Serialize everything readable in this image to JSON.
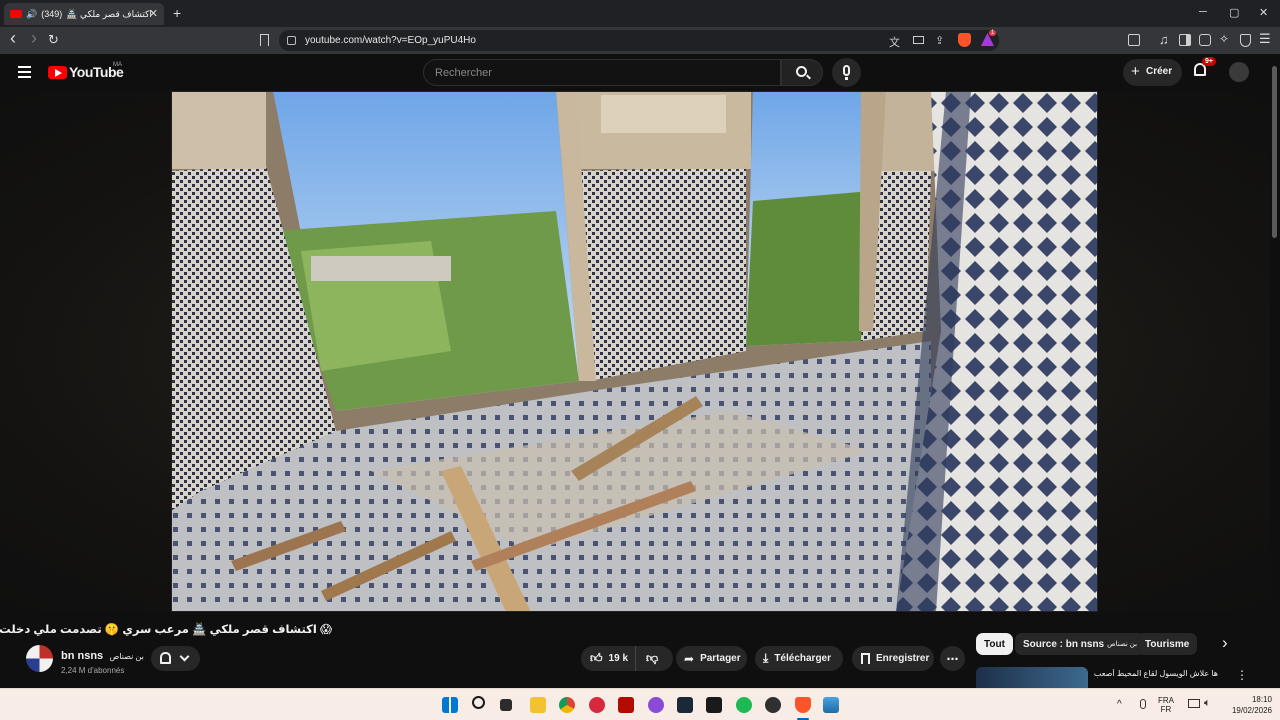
{
  "browser": {
    "tab": {
      "notification_count": "(349)",
      "title": "اكتشاف قصر ملكي 🏯",
      "close_glyph": "✕"
    },
    "new_tab_glyph": "+",
    "window": {
      "minimize": "─",
      "maximize": "▢",
      "close": "✕"
    },
    "nav": {
      "back": "‹",
      "forward": "›",
      "reload": "↻"
    },
    "url": "youtube.com/watch?v=EOp_yuPU4Ho",
    "brave_badge": "1",
    "wallet_badge": "1"
  },
  "youtube": {
    "logo_text": "YouTube",
    "region": "MA",
    "search_placeholder": "Rechercher",
    "create_label": "Créer",
    "notifications_badge": "9+"
  },
  "video": {
    "title": "😱 اكتشاف قصر ملكي 🏯 مرعب سري 🤫 تصدمت ملي دخلت ليه 👑",
    "channel_name": "bn nsns",
    "channel_name_ar": "بن نصناص",
    "subscribers": "2,24 M d'abonnés",
    "likes": "19 k",
    "share_label": "Partager",
    "download_label": "Télécharger",
    "save_label": "Enregistrer",
    "more_glyph": "⋯"
  },
  "chips": {
    "all": "Tout",
    "source": "Source : bn nsns",
    "source_ar": "بن نصناص",
    "tourism": "Tourisme",
    "next_glyph": "›"
  },
  "recommendation": {
    "title": "ها علاش الويسول لقاع المحيط أصعب من"
  },
  "taskbar": {
    "language": "FRA",
    "layout": "FR",
    "time": "18:10",
    "date": "19/02/2026",
    "tray_chevron": "^"
  }
}
